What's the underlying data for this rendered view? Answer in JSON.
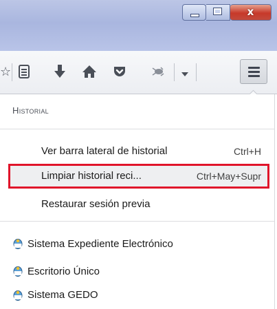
{
  "toolbar": {
    "icons": [
      "bookmark-star-icon",
      "reading-list-icon",
      "downloads-icon",
      "home-icon",
      "pocket-icon",
      "bug-icon",
      "dropdown-icon",
      "hamburger-menu-icon"
    ]
  },
  "panel": {
    "section_title": "Historial",
    "items": [
      {
        "label": "Ver barra lateral de historial",
        "accel": "Ctrl+H"
      },
      {
        "label": "Limpiar historial reci...",
        "accel": "Ctrl+May+Supr"
      },
      {
        "label": "Restaurar sesión previa",
        "accel": ""
      }
    ],
    "bookmarks": [
      {
        "label": "Sistema Expediente Electrónico"
      },
      {
        "label": "Escritorio Único"
      },
      {
        "label": "Sistema GEDO"
      }
    ]
  },
  "colors": {
    "highlight_border": "#e0142a",
    "titlebar": "#b1bde3",
    "close_button": "#c7392a"
  }
}
